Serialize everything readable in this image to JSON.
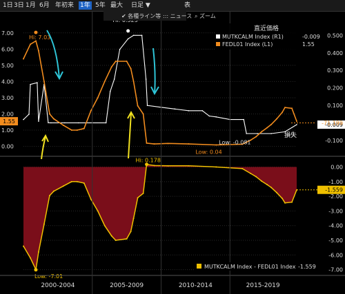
{
  "toolbar": {
    "ranges": [
      "1日",
      "3日",
      "1月",
      "6月",
      "年初来",
      "1年",
      "5年",
      "最大"
    ],
    "active_range": "1年",
    "period_label": "日足 ▼",
    "table_label": "表",
    "toolbar_items": [
      "✔ 各種ライン等",
      "::: ニュース",
      "⌕ ズーム"
    ]
  },
  "legend": {
    "header": "直近価格",
    "items": [
      {
        "name": "MUTKCALM Index (R1)",
        "value": "-0.009",
        "color": "#ffffff"
      },
      {
        "name": "FEDL01 Index (L1)",
        "value": "1.55",
        "color": "#f28c1e"
      }
    ],
    "bottom_item": {
      "name": "MUTKCALM Index - FEDL01 Index",
      "value": "-1.559",
      "color": "#f0c000"
    }
  },
  "annotations": {
    "hi_fed": "Hi: 7.03",
    "hi_mut": "Hi: 0.525",
    "low_fed": "Low: 0.04",
    "low_mut": "Low: -0.081",
    "hi_spread": "Hi: 0.178",
    "low_spread": "Low: -7.01",
    "loss_label": "損失"
  },
  "axis_tags": {
    "left_fed": "1.55",
    "right_mut": "-0.009",
    "right_orange": "-71.199",
    "right_spread": "-1.559"
  },
  "x_labels": [
    "2000-2004",
    "2005-2009",
    "2010-2014",
    "2015-2019"
  ],
  "colors": {
    "fed": "#f28c1e",
    "mut": "#ffffff",
    "spread": "#f0c000",
    "fill": "#7a0e1a",
    "arrow_cyan": "#2ec4d6",
    "arrow_yellow": "#f0e020"
  },
  "chart_data": [
    {
      "type": "line",
      "title": "",
      "y_left_ticks": [
        "7.00",
        "6.00",
        "5.00",
        "4.00",
        "3.00",
        "2.00",
        "1.00",
        "0.00"
      ],
      "y_right_ticks": [
        "0.500",
        "0.400",
        "0.300",
        "0.200",
        "0.100",
        "0.000",
        "-0.100"
      ],
      "ylim_left": [
        -0.4,
        7.5
      ],
      "ylim_right": [
        -0.17,
        0.56
      ],
      "series": [
        {
          "name": "FEDL01 Index (L1)",
          "axis": "left",
          "x": [
            2000.0,
            2000.5,
            2000.9,
            2001.1,
            2001.5,
            2001.9,
            2002.2,
            2002.9,
            2003.5,
            2003.9,
            2004.4,
            2004.9,
            2005.4,
            2005.9,
            2006.4,
            2006.7,
            2007.5,
            2007.8,
            2008.0,
            2008.3,
            2008.7,
            2008.95,
            2009.5,
            2010.5,
            2012.0,
            2014.0,
            2015.9,
            2016.5,
            2016.9,
            2017.3,
            2017.7,
            2018.0,
            2018.4,
            2018.8,
            2019.0,
            2019.5,
            2019.85
          ],
          "values": [
            5.4,
            6.3,
            6.5,
            5.9,
            4.0,
            2.0,
            1.7,
            1.3,
            1.0,
            1.0,
            1.1,
            2.2,
            3.0,
            4.0,
            4.9,
            5.25,
            5.25,
            4.8,
            4.0,
            2.5,
            2.0,
            0.2,
            0.15,
            0.18,
            0.15,
            0.09,
            0.13,
            0.38,
            0.6,
            0.9,
            1.15,
            1.35,
            1.7,
            2.1,
            2.4,
            2.35,
            1.55
          ]
        },
        {
          "name": "MUTKCALM Index (R1)",
          "axis": "right",
          "x": [
            2000.0,
            2000.4,
            2000.5,
            2001.0,
            2001.1,
            2001.5,
            2001.8,
            2002.0,
            2003.0,
            2004.0,
            2005.0,
            2006.0,
            2006.3,
            2006.6,
            2007.0,
            2007.6,
            2008.0,
            2008.6,
            2008.9,
            2009.0,
            2010.0,
            2011.0,
            2012.0,
            2013.0,
            2013.5,
            2014.0,
            2015.0,
            2016.0,
            2016.2,
            2017.0,
            2018.0,
            2019.0,
            2019.85
          ],
          "values": [
            0.02,
            0.05,
            0.22,
            0.23,
            0.01,
            0.22,
            0.002,
            0.001,
            0.001,
            0.001,
            0.001,
            0.001,
            0.18,
            0.25,
            0.42,
            0.48,
            0.5,
            0.5,
            0.25,
            0.1,
            0.09,
            0.08,
            0.07,
            0.07,
            0.04,
            0.035,
            0.02,
            0.02,
            -0.06,
            -0.06,
            -0.06,
            -0.05,
            -0.009
          ]
        }
      ]
    },
    {
      "type": "area",
      "title": "",
      "y_ticks": [
        "0.00",
        "-1.00",
        "-2.00",
        "-3.00",
        "-4.00",
        "-5.00",
        "-6.00",
        "-7.00"
      ],
      "ylim": [
        -7.3,
        0.4
      ],
      "series": [
        {
          "name": "MUTKCALM Index - FEDL01 Index",
          "x": [
            2000.0,
            2000.5,
            2000.9,
            2001.1,
            2001.5,
            2001.9,
            2002.2,
            2002.9,
            2003.5,
            2003.9,
            2004.4,
            2004.9,
            2005.4,
            2005.9,
            2006.4,
            2006.7,
            2007.5,
            2007.8,
            2008.0,
            2008.3,
            2008.7,
            2008.95,
            2009.5,
            2010.5,
            2012.0,
            2014.0,
            2015.9,
            2016.5,
            2016.9,
            2017.3,
            2017.7,
            2018.0,
            2018.4,
            2018.8,
            2019.0,
            2019.5,
            2019.85
          ],
          "values": [
            -5.4,
            -6.2,
            -7.0,
            -5.8,
            -3.9,
            -1.95,
            -1.65,
            -1.3,
            -1.0,
            -1.0,
            -1.1,
            -2.2,
            -3.0,
            -4.0,
            -4.7,
            -5.0,
            -4.9,
            -4.4,
            -3.5,
            -2.1,
            -1.8,
            0.17,
            0.1,
            0.08,
            0.08,
            0.0,
            -0.11,
            -0.44,
            -0.66,
            -0.96,
            -1.2,
            -1.4,
            -1.75,
            -2.15,
            -2.45,
            -2.4,
            -1.559
          ]
        }
      ]
    }
  ]
}
